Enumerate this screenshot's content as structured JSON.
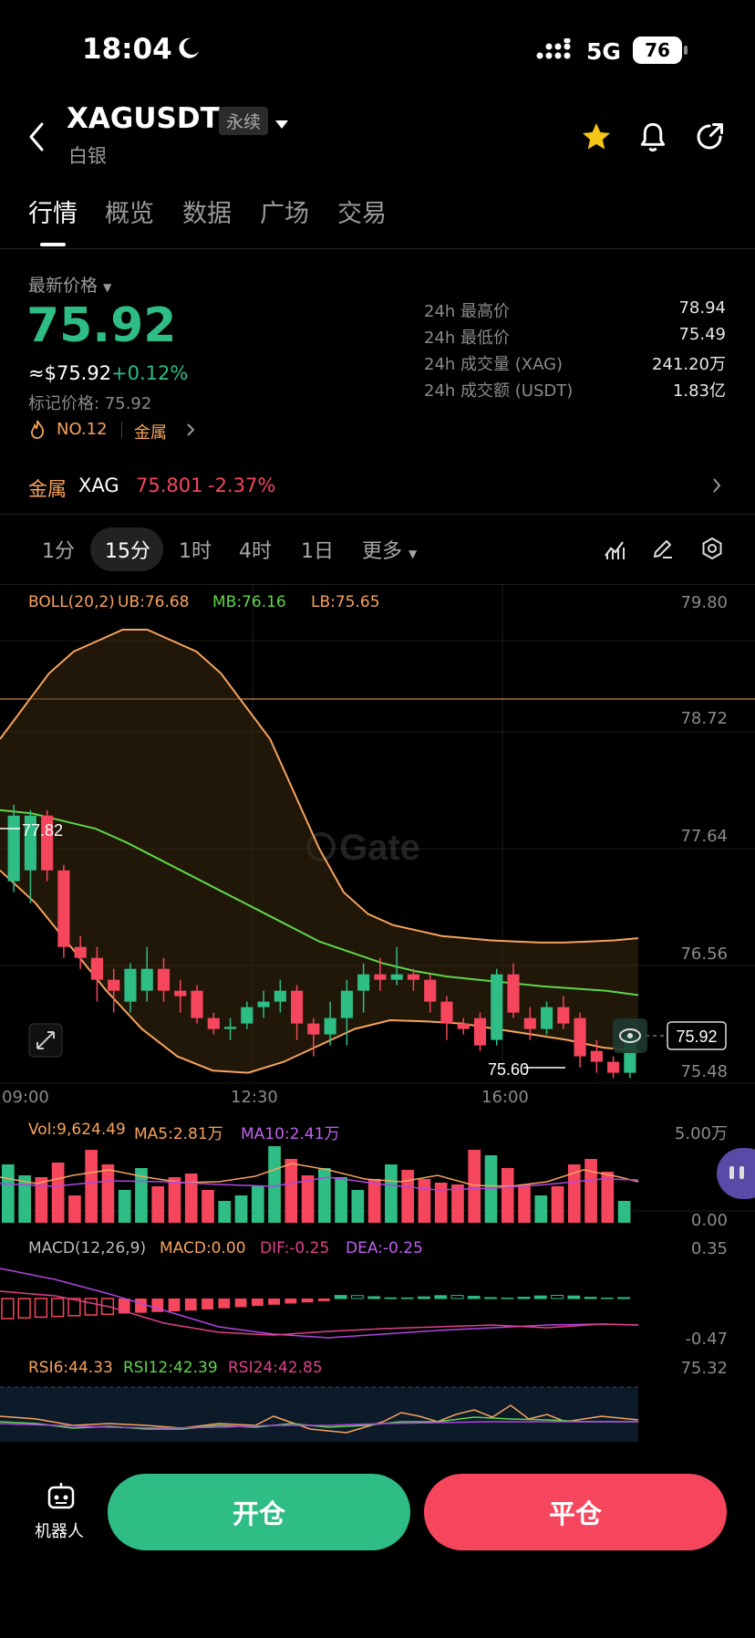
{
  "status_bar": {
    "time": "18:04",
    "network": "5G",
    "battery": "76"
  },
  "header": {
    "symbol": "XAGUSDT",
    "badge": "永续",
    "subtitle": "白银"
  },
  "tabs": [
    "行情",
    "概览",
    "数据",
    "广场",
    "交易"
  ],
  "price": {
    "label": "最新价格",
    "last": "75.92",
    "usd": "≈$75.92",
    "change": "+0.12%",
    "mark": "标记价格: 75.92",
    "rank": "NO.12",
    "category": "金属"
  },
  "stats": [
    {
      "label": "24h 最高价",
      "value": "78.94"
    },
    {
      "label": "24h 最低价",
      "value": "75.49"
    },
    {
      "label": "24h 成交量 (XAG)",
      "value": "241.20万"
    },
    {
      "label": "24h 成交额 (USDT)",
      "value": "1.83亿"
    }
  ],
  "related": {
    "category": "金属",
    "symbol": "XAG",
    "price": "75.801",
    "change": "-2.37%"
  },
  "timeframes": {
    "items": [
      "1分",
      "15分",
      "1时",
      "4时",
      "1日"
    ],
    "selected": "15分",
    "more": "更多"
  },
  "boll": {
    "label": "BOLL(20,2)",
    "ub": "UB:76.68",
    "mb": "MB:76.16",
    "lb": "LB:75.65"
  },
  "price_axis": [
    "79.80",
    "78.72",
    "77.64",
    "76.56",
    "75.48"
  ],
  "time_axis": [
    "09:00",
    "12:30",
    "16:00"
  ],
  "chart_marks": {
    "high": "77.82",
    "low": "75.60",
    "last": "75.92",
    "watermark": "Gate"
  },
  "volume": {
    "vol": "Vol:9,624.49",
    "ma5": "MA5:2.81万",
    "ma10": "MA10:2.41万",
    "max": "5.00万",
    "min": "0.00"
  },
  "macd": {
    "label": "MACD(12,26,9)",
    "macd": "MACD:0.00",
    "dif": "DIF:-0.25",
    "dea": "DEA:-0.25",
    "max": "0.35",
    "min": "-0.47"
  },
  "rsi": {
    "rsi6": "RSI6:44.33",
    "rsi12": "RSI12:42.39",
    "rsi24": "RSI24:42.85",
    "max": "75.32"
  },
  "bottom": {
    "robot": "机器人",
    "open": "开仓",
    "close": "平仓"
  },
  "colors": {
    "up": "#2ebd85",
    "down": "#f6465d",
    "accent_orange": "#f7a35c",
    "star": "#f5c518"
  },
  "chart_data": {
    "type": "candlestick",
    "ylim": [
      75.48,
      79.8
    ],
    "candles": [
      {
        "o": 77.2,
        "c": 77.8,
        "h": 77.9,
        "l": 77.1
      },
      {
        "o": 77.3,
        "c": 77.8,
        "h": 77.85,
        "l": 77.0
      },
      {
        "o": 77.8,
        "c": 77.3,
        "h": 77.85,
        "l": 77.2
      },
      {
        "o": 77.3,
        "c": 76.6,
        "h": 77.35,
        "l": 76.5
      },
      {
        "o": 76.6,
        "c": 76.5,
        "h": 76.7,
        "l": 76.4
      },
      {
        "o": 76.5,
        "c": 76.3,
        "h": 76.6,
        "l": 76.1
      },
      {
        "o": 76.3,
        "c": 76.2,
        "h": 76.4,
        "l": 76.0
      },
      {
        "o": 76.1,
        "c": 76.4,
        "h": 76.45,
        "l": 76.0
      },
      {
        "o": 76.2,
        "c": 76.4,
        "h": 76.6,
        "l": 76.1
      },
      {
        "o": 76.4,
        "c": 76.2,
        "h": 76.5,
        "l": 76.1
      },
      {
        "o": 76.2,
        "c": 76.15,
        "h": 76.3,
        "l": 76.0
      },
      {
        "o": 76.2,
        "c": 75.95,
        "h": 76.25,
        "l": 75.9
      },
      {
        "o": 75.95,
        "c": 75.85,
        "h": 76.0,
        "l": 75.8
      },
      {
        "o": 75.85,
        "c": 75.87,
        "h": 75.95,
        "l": 75.75
      },
      {
        "o": 75.9,
        "c": 76.05,
        "h": 76.1,
        "l": 75.85
      },
      {
        "o": 76.05,
        "c": 76.1,
        "h": 76.2,
        "l": 75.95
      },
      {
        "o": 76.1,
        "c": 76.2,
        "h": 76.3,
        "l": 76.0
      },
      {
        "o": 76.2,
        "c": 75.9,
        "h": 76.25,
        "l": 75.75
      },
      {
        "o": 75.9,
        "c": 75.8,
        "h": 75.95,
        "l": 75.6
      },
      {
        "o": 75.8,
        "c": 75.95,
        "h": 76.1,
        "l": 75.7
      },
      {
        "o": 75.95,
        "c": 76.2,
        "h": 76.3,
        "l": 75.7
      },
      {
        "o": 76.2,
        "c": 76.35,
        "h": 76.45,
        "l": 76.0
      },
      {
        "o": 76.35,
        "c": 76.3,
        "h": 76.5,
        "l": 76.2
      },
      {
        "o": 76.3,
        "c": 76.35,
        "h": 76.6,
        "l": 76.25
      },
      {
        "o": 76.35,
        "c": 76.3,
        "h": 76.4,
        "l": 76.2
      },
      {
        "o": 76.3,
        "c": 76.1,
        "h": 76.35,
        "l": 76.0
      },
      {
        "o": 76.1,
        "c": 75.9,
        "h": 76.15,
        "l": 75.75
      },
      {
        "o": 75.9,
        "c": 75.85,
        "h": 75.95,
        "l": 75.8
      },
      {
        "o": 75.95,
        "c": 75.7,
        "h": 76.0,
        "l": 75.65
      },
      {
        "o": 75.75,
        "c": 76.35,
        "h": 76.4,
        "l": 75.7
      },
      {
        "o": 76.35,
        "c": 76.0,
        "h": 76.45,
        "l": 75.95
      },
      {
        "o": 75.95,
        "c": 75.85,
        "h": 76.05,
        "l": 75.75
      },
      {
        "o": 75.85,
        "c": 76.05,
        "h": 76.1,
        "l": 75.8
      },
      {
        "o": 76.05,
        "c": 75.9,
        "h": 76.15,
        "l": 75.85
      },
      {
        "o": 75.95,
        "c": 75.6,
        "h": 76.0,
        "l": 75.5
      },
      {
        "o": 75.65,
        "c": 75.55,
        "h": 75.75,
        "l": 75.45
      },
      {
        "o": 75.55,
        "c": 75.45,
        "h": 75.6,
        "l": 75.4
      },
      {
        "o": 75.45,
        "c": 75.8,
        "h": 75.85,
        "l": 75.4
      }
    ],
    "ub": [
      78.5,
      78.8,
      79.1,
      79.3,
      79.4,
      79.5,
      79.5,
      79.4,
      79.3,
      79.1,
      78.8,
      78.5,
      78.0,
      77.5,
      77.1,
      76.9,
      76.8,
      76.75,
      76.7,
      76.68,
      76.66,
      76.65,
      76.64,
      76.64,
      76.65,
      76.66,
      76.68
    ],
    "mb": [
      77.85,
      77.82,
      77.75,
      77.68,
      77.55,
      77.4,
      77.25,
      77.1,
      76.95,
      76.8,
      76.65,
      76.55,
      76.45,
      76.38,
      76.33,
      76.3,
      76.27,
      76.24,
      76.22,
      76.2,
      76.16
    ],
    "lb": [
      77.3,
      77.0,
      76.6,
      76.2,
      75.85,
      75.6,
      75.47,
      75.45,
      75.55,
      75.7,
      75.85,
      75.93,
      75.92,
      75.9,
      75.85,
      75.8,
      75.75,
      75.68,
      75.65
    ],
    "volume": [
      3.2,
      2.6,
      2.5,
      3.3,
      1.5,
      4.0,
      3.2,
      1.8,
      3.0,
      2.0,
      2.5,
      2.7,
      1.8,
      1.2,
      1.5,
      2.0,
      4.2,
      3.5,
      2.6,
      3.0,
      2.5,
      1.8,
      2.4,
      3.2,
      2.9,
      2.4,
      2.2,
      2.1,
      4.0,
      3.7,
      3.0,
      2.1,
      1.5,
      2.0,
      3.2,
      3.5,
      2.8,
      1.2
    ]
  }
}
